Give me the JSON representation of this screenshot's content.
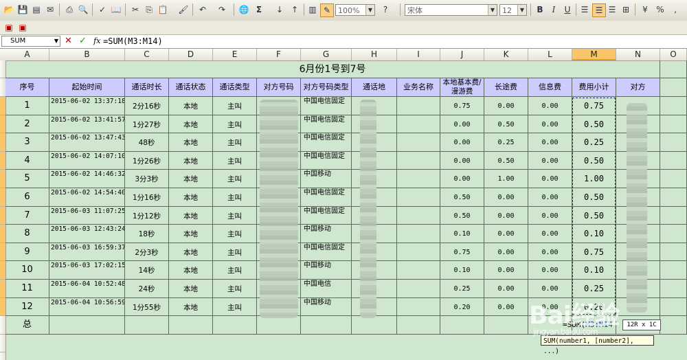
{
  "toolbar": {
    "zoom": "100%",
    "font_name": "宋体",
    "font_size": "12",
    "bold": "B",
    "italic": "I",
    "underline": "U",
    "sum_symbol": "Σ"
  },
  "formula_bar": {
    "name_box": "SUM",
    "cancel": "✕",
    "enter": "✓",
    "fx": "fx",
    "formula": "=SUM(M3:M14)"
  },
  "columns": [
    "A",
    "B",
    "C",
    "D",
    "E",
    "F",
    "G",
    "H",
    "I",
    "J",
    "K",
    "L",
    "M",
    "N",
    "O"
  ],
  "sheet": {
    "title": "6月份1号到7号",
    "headers": [
      "序号",
      "起始时间",
      "通话时长",
      "通话状态",
      "通话类型",
      "对方号码",
      "对方号码类型",
      "通话地",
      "业务名称",
      "本地基本费/漫游费",
      "长途费",
      "信息费",
      "费用小计",
      "对方"
    ],
    "rows": [
      {
        "idx": "1",
        "time": "2015-06-02 13:37:18",
        "dur": "2分16秒",
        "status": "本地",
        "type": "主叫",
        "ntype": "中国电信固定",
        "base": "0.75",
        "ld": "0.00",
        "info": "0.00",
        "sub": "0.75"
      },
      {
        "idx": "2",
        "time": "2015-06-02 13:41:57",
        "dur": "1分27秒",
        "status": "本地",
        "type": "主叫",
        "ntype": "中国电信固定",
        "base": "0.00",
        "ld": "0.50",
        "info": "0.00",
        "sub": "0.50"
      },
      {
        "idx": "3",
        "time": "2015-06-02 13:47:43",
        "dur": "48秒",
        "status": "本地",
        "type": "主叫",
        "ntype": "中国电信固定",
        "base": "0.00",
        "ld": "0.25",
        "info": "0.00",
        "sub": "0.25"
      },
      {
        "idx": "4",
        "time": "2015-06-02 14:07:10",
        "dur": "1分26秒",
        "status": "本地",
        "type": "主叫",
        "ntype": "中国电信固定",
        "base": "0.00",
        "ld": "0.50",
        "info": "0.00",
        "sub": "0.50"
      },
      {
        "idx": "5",
        "time": "2015-06-02 14:46:32",
        "dur": "3分3秒",
        "status": "本地",
        "type": "主叫",
        "ntype": "中国移动",
        "base": "0.00",
        "ld": "1.00",
        "info": "0.00",
        "sub": "1.00"
      },
      {
        "idx": "6",
        "time": "2015-06-02 14:54:40",
        "dur": "1分16秒",
        "status": "本地",
        "type": "主叫",
        "ntype": "中国电信固定",
        "base": "0.50",
        "ld": "0.00",
        "info": "0.00",
        "sub": "0.50"
      },
      {
        "idx": "7",
        "time": "2015-06-03 11:07:25",
        "dur": "1分12秒",
        "status": "本地",
        "type": "主叫",
        "ntype": "中国电信固定",
        "base": "0.50",
        "ld": "0.00",
        "info": "0.00",
        "sub": "0.50"
      },
      {
        "idx": "8",
        "time": "2015-06-03 12:43:24",
        "dur": "18秒",
        "status": "本地",
        "type": "主叫",
        "ntype": "中国移动",
        "base": "0.10",
        "ld": "0.00",
        "info": "0.00",
        "sub": "0.10"
      },
      {
        "idx": "9",
        "time": "2015-06-03 16:59:37",
        "dur": "2分3秒",
        "status": "本地",
        "type": "主叫",
        "ntype": "中国电信固定",
        "base": "0.75",
        "ld": "0.00",
        "info": "0.00",
        "sub": "0.75"
      },
      {
        "idx": "10",
        "time": "2015-06-03 17:02:15",
        "dur": "14秒",
        "status": "本地",
        "type": "主叫",
        "ntype": "中国移动",
        "base": "0.10",
        "ld": "0.00",
        "info": "0.00",
        "sub": "0.10"
      },
      {
        "idx": "11",
        "time": "2015-06-04 10:52:48",
        "dur": "24秒",
        "status": "本地",
        "type": "主叫",
        "ntype": "中国电信",
        "base": "0.25",
        "ld": "0.00",
        "info": "0.00",
        "sub": "0.25"
      },
      {
        "idx": "12",
        "time": "2015-06-04 10:56:59",
        "dur": "1分55秒",
        "status": "本地",
        "type": "主叫",
        "ntype": "中国移动",
        "base": "0.20",
        "ld": "0.00",
        "info": "0.00",
        "sub": "0.20"
      }
    ],
    "total_label": "总"
  },
  "editing": {
    "func": "=SUM(",
    "range": "M3:M14",
    "size_tip": "12R x 1C",
    "arg_tip": "SUM(number1, [number2], ...)"
  },
  "watermark": {
    "text": "Bai经验",
    "sub": "jingyan.baidu.com"
  }
}
